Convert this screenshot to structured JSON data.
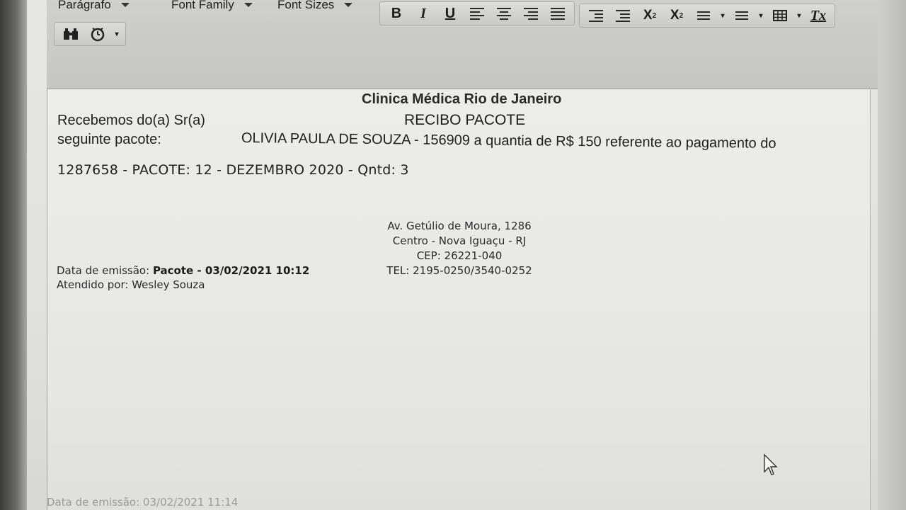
{
  "toolbar": {
    "paragraph_label": "Parágrafo",
    "font_family_label": "Font Family",
    "font_sizes_label": "Font Sizes",
    "bold": "B",
    "italic": "I",
    "underline": "U",
    "subscript": "X",
    "subscript_mark": "2",
    "superscript": "X",
    "superscript_mark": "2",
    "clear_format": "Tx"
  },
  "document": {
    "clinic_name": "Clinica Médica Rio de Janeiro",
    "title": "RECIBO PACOTE",
    "received_from_prefix": "Recebemos do(a) Sr(a)",
    "received_from_rest": "OLIVIA PAULA DE SOUZA - 156909 a quantia de R$ 150 referente ao pagamento do",
    "line2": "seguinte pacote:",
    "line3": "1287658 - PACOTE: 12 - DEZEMBRO 2020 - Qntd: 3",
    "address": {
      "street": "Av. Getúlio de Moura, 1286",
      "district": "Centro - Nova Iguaçu - RJ",
      "cep": "CEP: 26221-040",
      "tel": "TEL: 2195-0250/3540-0252"
    },
    "emission_label": "Data de emissão:",
    "emission_value": "Pacote - 03/02/2021 10:12",
    "attended_by": "Atendido por: Wesley Souza"
  },
  "footer": {
    "ghost_text": "Data de emissão: 03/02/2021 11:14"
  }
}
